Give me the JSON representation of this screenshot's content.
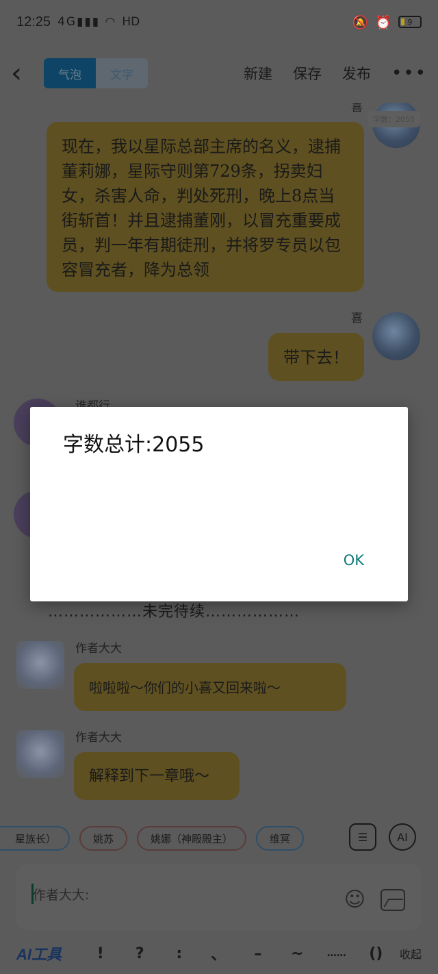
{
  "status_bar": {
    "time": "12:25",
    "signal_text": "4G",
    "network_label": "HD",
    "battery_level": "9"
  },
  "top_bar": {
    "tabs": [
      {
        "label": "气泡",
        "active": true
      },
      {
        "label": "文字",
        "active": false
      }
    ],
    "actions": {
      "new_label": "新建",
      "save_label": "保存",
      "publish_label": "发布",
      "more_label": "•••"
    }
  },
  "chat": {
    "count_tag": "字数：2055",
    "messages": [
      {
        "sender": "喜",
        "text": "现在，我以星际总部主席的名义，逮捕董莉娜，星际守则第729条，拐卖妇女，杀害人命，判处死刑，晚上8点当街斩首！并且逮捕董刚，以冒充重要成员，判一年有期徒刑，并将罗专员以包容冒充者，降为总领"
      },
      {
        "sender": "喜",
        "text": "带下去！"
      },
      {
        "sender": "谁都行",
        "text": ""
      },
      {
        "sender": "作者大大",
        "text": "啦啦啦～你们的小喜又回来啦～"
      },
      {
        "sender": "作者大大",
        "text": "解释到下一章哦～"
      }
    ],
    "to_be_continued": "………………未完待续………………"
  },
  "character_chips": [
    {
      "label": "星族长）",
      "color": "#2f4f68"
    },
    {
      "label": "姚苏",
      "color": "#5a3b3b"
    },
    {
      "label": "姚娜（神殿殿主）",
      "color": "#5a3b3b"
    },
    {
      "label": "维冥",
      "color": "#2f4f68"
    }
  ],
  "tool_buttons": {
    "card_icon": "contact-card-icon",
    "ai_label": "AI"
  },
  "input": {
    "placeholder": "作者大大:"
  },
  "bottom_bar": {
    "ai_tools_label": "AI工具",
    "symbols": [
      "!",
      "?",
      ":",
      "、",
      "–",
      "~",
      "……",
      "()"
    ],
    "collapse_label": "收起"
  },
  "dialog": {
    "message": "字数总计:2055",
    "ok_label": "OK"
  },
  "colors": {
    "overlay_dim": "#5b5b5b",
    "bubble": "#5e5020",
    "accent_ok": "#0f7a7a",
    "dialog_bg": "#ffffff"
  }
}
